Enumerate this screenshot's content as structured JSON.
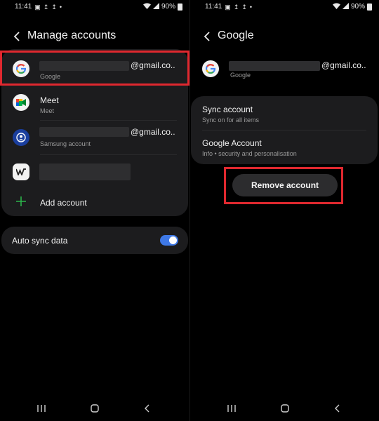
{
  "status": {
    "time": "11:41",
    "battery": "90%"
  },
  "left": {
    "title": "Manage accounts",
    "accounts": [
      {
        "name_suffix": "@gmail.co..",
        "type": "Google",
        "icon": "google-icon"
      },
      {
        "name": "Meet",
        "type": "Meet",
        "icon": "meet-icon"
      },
      {
        "name_suffix": "@gmail.co..",
        "type": "Samsung account",
        "icon": "samsung-account-icon"
      },
      {
        "icon": "wps-icon"
      }
    ],
    "add_account": "Add account",
    "auto_sync_label": "Auto sync data",
    "auto_sync_on": true
  },
  "right": {
    "title": "Google",
    "account": {
      "name_suffix": "@gmail.co..",
      "type": "Google",
      "icon": "google-icon"
    },
    "sync_title": "Sync account",
    "sync_sub": "Sync on for all items",
    "ga_title": "Google Account",
    "ga_sub": "Info  •  security and personalisation",
    "remove_label": "Remove account"
  },
  "colors": {
    "accent": "#3e78e6",
    "highlight": "#e0282f",
    "card": "#1c1c1e"
  },
  "navbar": [
    "recents-icon",
    "home-icon",
    "back-icon"
  ]
}
